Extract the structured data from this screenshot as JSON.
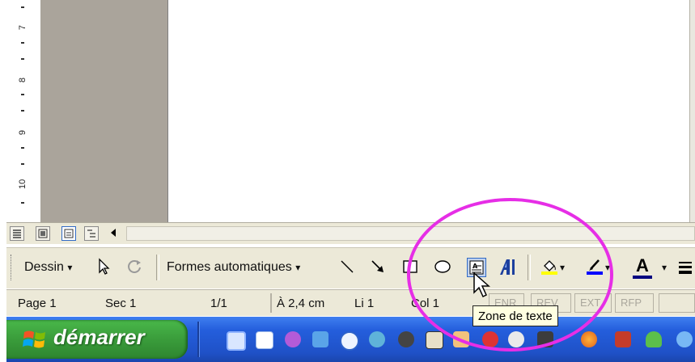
{
  "ruler": {
    "labels": [
      "7",
      "8",
      "9",
      "10"
    ]
  },
  "toolbar": {
    "drawing_label": "Dessin",
    "autoshapes_label": "Formes automatiques",
    "dropdown_arrow": "▾",
    "font_color_letter": "A"
  },
  "status": {
    "page": "Page 1",
    "section": "Sec 1",
    "page_count": "1/1",
    "position": "À 2,4 cm",
    "line": "Li 1",
    "column": "Col 1",
    "indicators": [
      "ENR",
      "REV",
      "EXT",
      "RFP"
    ]
  },
  "tooltip": {
    "text": "Zone de texte"
  },
  "taskbar": {
    "start_label": "démarrer"
  },
  "colors": {
    "highlight": "#e62ee6",
    "fill_color": "#ffff00",
    "line_color": "#0000ff",
    "font_color": "#000080",
    "start_green": "#3a9c3b",
    "taskbar_blue": "#245edc"
  }
}
